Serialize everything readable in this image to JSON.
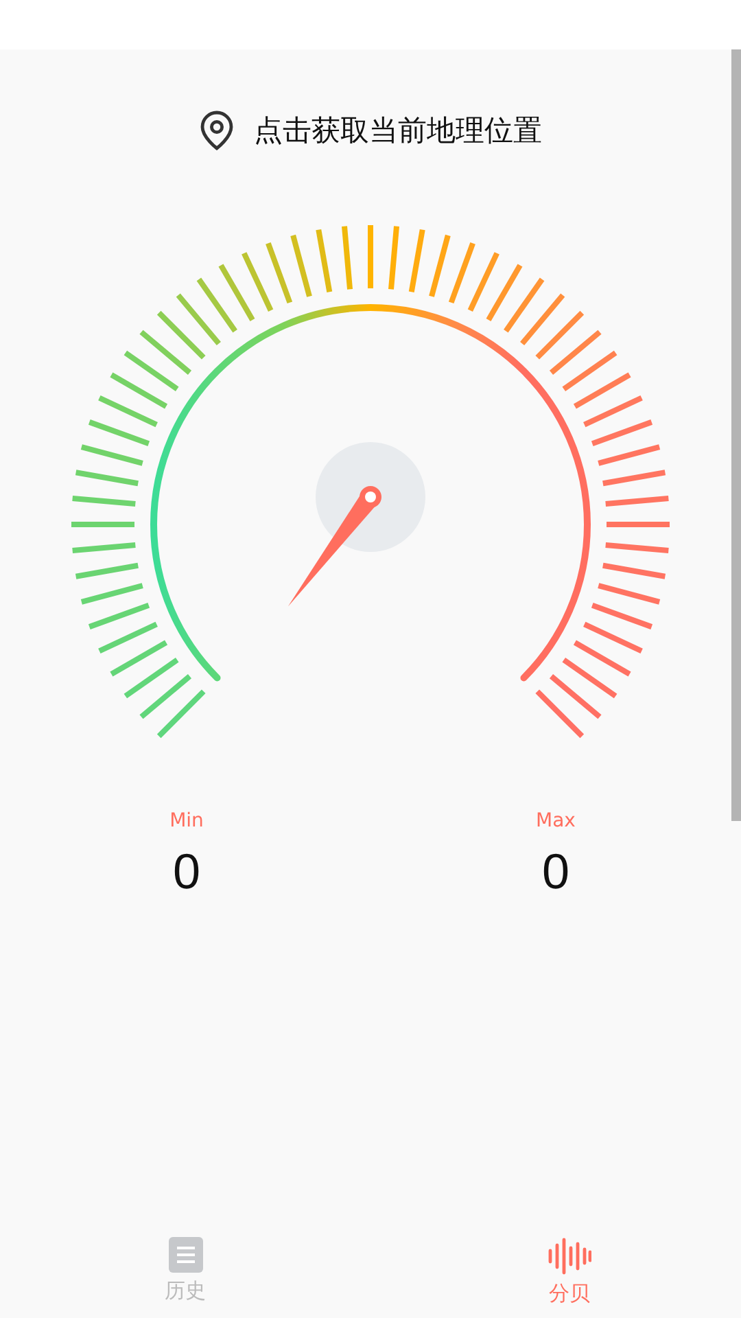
{
  "location": {
    "text": "点击获取当前地理位置"
  },
  "stats": [
    {
      "label": "Min",
      "value": "0"
    },
    {
      "label": "Max",
      "value": "0"
    }
  ],
  "nav": [
    {
      "label": "历史",
      "kind": "list",
      "selected": false
    },
    {
      "label": "分贝",
      "kind": "wave",
      "selected": true
    }
  ]
}
